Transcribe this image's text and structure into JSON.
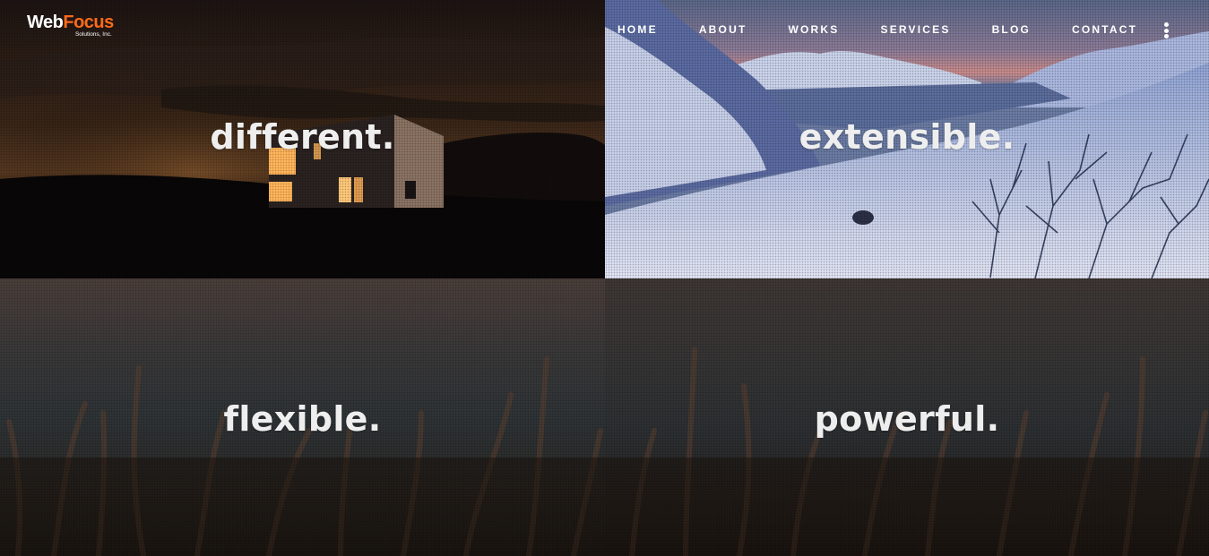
{
  "brand": {
    "logo_word_1": "Web",
    "logo_word_2": "Focus",
    "logo_tagline": "Solutions, Inc.",
    "accent_color": "#ff6a1a"
  },
  "nav": {
    "items": [
      {
        "label": "HOME"
      },
      {
        "label": "ABOUT"
      },
      {
        "label": "WORKS"
      },
      {
        "label": "SERVICES"
      },
      {
        "label": "BLOG"
      },
      {
        "label": "CONTACT"
      }
    ],
    "menu_icon": "kebab-menu-icon"
  },
  "panels": [
    {
      "word": "different.",
      "scene": "night cabin under cloudy sky"
    },
    {
      "word": "extensible.",
      "scene": "snowy mountains and fjord at dusk"
    },
    {
      "word": "flexible.",
      "scene": "blurred grass by the water"
    },
    {
      "word": "powerful.",
      "scene": "blurred grass by the water"
    }
  ]
}
